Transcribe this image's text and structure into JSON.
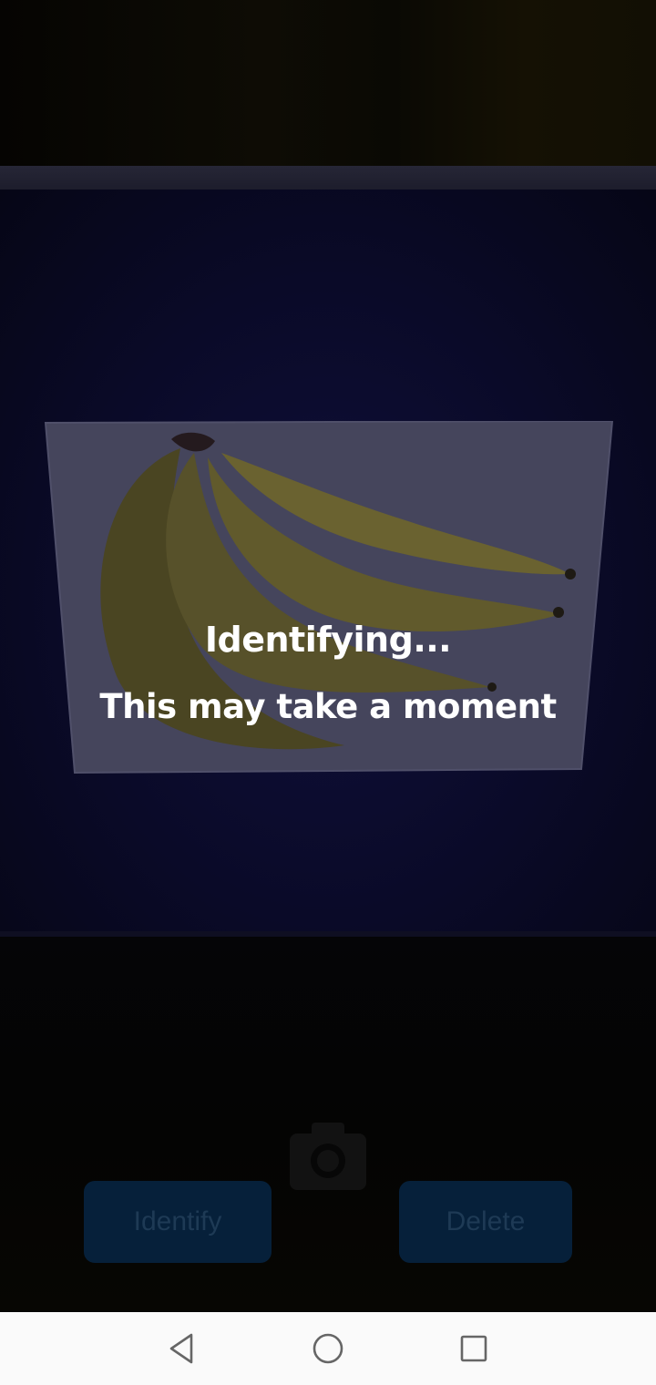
{
  "loading": {
    "title": "Identifying...",
    "subtitle": "This may take a moment"
  },
  "actions": {
    "identify_label": "Identify",
    "delete_label": "Delete",
    "capture_icon": "camera-icon"
  },
  "nav_bar": {
    "back_icon": "back-triangle-icon",
    "home_icon": "home-circle-icon",
    "recents_icon": "recents-square-icon"
  },
  "colors": {
    "button_bg": "#06203a",
    "button_text": "#1e3a55",
    "overlay_text": "#ffffff",
    "nav_bar_bg": "#fafafa",
    "nav_icon": "#666666"
  }
}
